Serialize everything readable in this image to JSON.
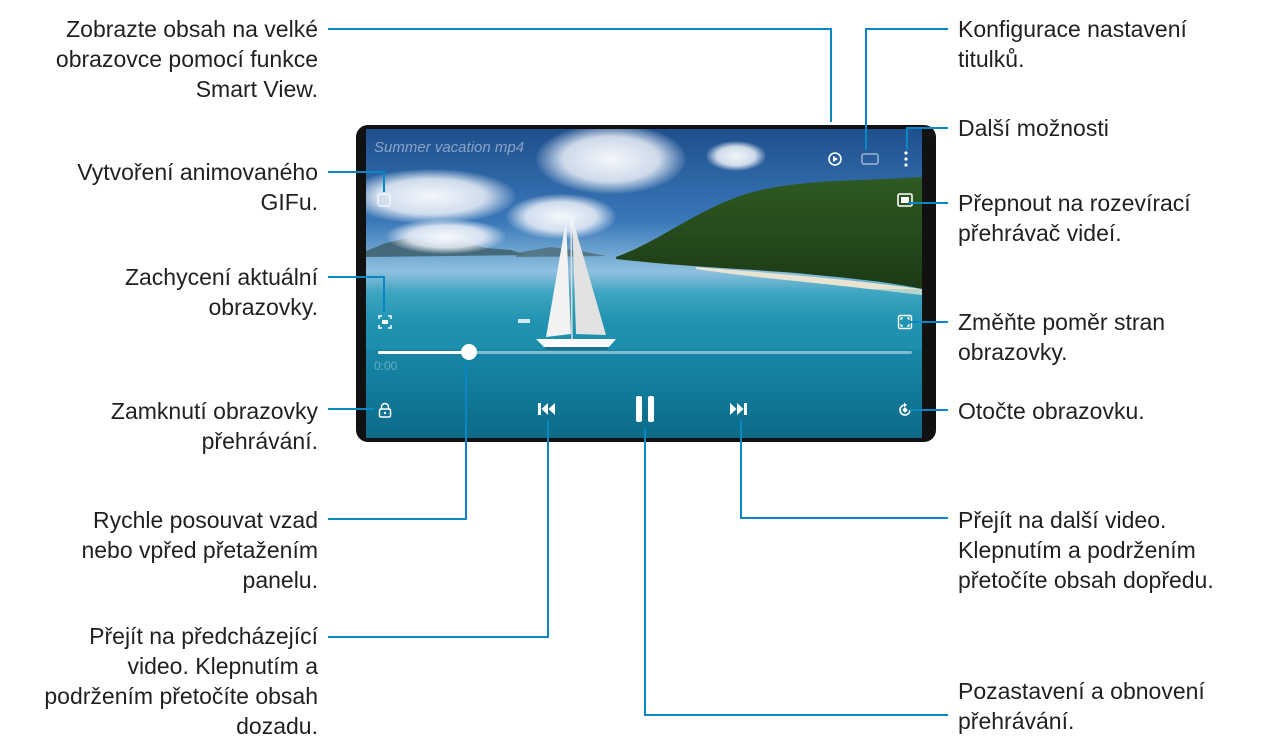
{
  "player": {
    "title": "Summer vacation mp4",
    "time_elapsed": "0:00",
    "progress_fraction": 0.17
  },
  "callouts": {
    "smart_view": "Zobrazte obsah na velké\nobrazovce pomocí funkce\nSmart View.",
    "gif": "Vytvoření animovaného\nGIFu.",
    "capture": "Zachycení aktuální\nobrazovky.",
    "lock": "Zamknutí obrazovky\npřehrávání.",
    "seek": "Rychle posouvat vzad\nnebo vpřed přetažením\npanelu.",
    "previous": "Přejít na předcházející\nvideo. Klepnutím a\npodržením přetočíte obsah\ndozadu.",
    "subtitles": "Konfigurace nastavení\ntitulků.",
    "more": "Další možnosti",
    "popup": "Přepnout na rozevírací\npřehrávač videí.",
    "ratio": "Změňte poměr stran\nobrazovky.",
    "rotate": "Otočte obrazovku.",
    "next": "Přejít na další video.\nKlepnutím a podržením\npřetočíte obsah dopředu.",
    "pause": "Pozastavení a obnovení\npřehrávání."
  },
  "icons": {
    "smart_view": "smart-view-icon",
    "subtitles": "subtitles-icon",
    "more": "more-options-icon",
    "gif": "gif-icon",
    "popup": "popup-player-icon",
    "capture": "capture-icon",
    "ratio": "aspect-ratio-icon",
    "lock": "lock-icon",
    "rotate": "rotate-icon",
    "previous": "previous-icon",
    "pause": "pause-icon",
    "next": "next-icon"
  },
  "colors": {
    "leader_line": "#0a86c4",
    "text": "#231f20"
  }
}
